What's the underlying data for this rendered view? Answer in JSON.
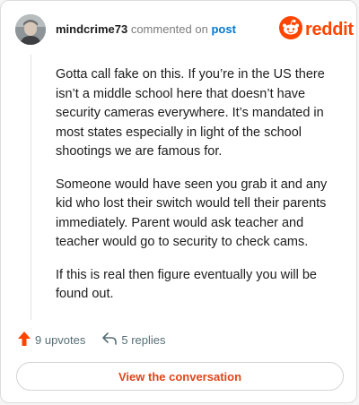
{
  "header": {
    "username": "mindcrime73",
    "action_text": "commented on",
    "post_link": "post"
  },
  "brand": {
    "wordmark": "reddit",
    "color": "#ff4500",
    "icon": "reddit-alien-icon"
  },
  "comment": {
    "paragraphs": [
      "Gotta call fake on this. If you’re in the US there isn’t a middle school here that doesn’t have security cameras everywhere. It’s mandated in most states especially in light of the school shootings we are famous for.",
      "Someone would have seen you grab it and any kid who lost their switch would tell their parents immediately. Parent would ask teacher and teacher would go to security to check cams.",
      "If this is real then figure eventually you will be found out."
    ]
  },
  "stats": {
    "upvotes": "9 upvotes",
    "replies": "5 replies",
    "upvote_icon": "upvote-arrow-icon",
    "reply_icon": "reply-arrow-icon"
  },
  "cta": {
    "label": "View the conversation"
  },
  "colors": {
    "accent": "#ff4500",
    "link": "#0079d3",
    "cta_text": "#e0451a",
    "muted": "#576f76"
  }
}
